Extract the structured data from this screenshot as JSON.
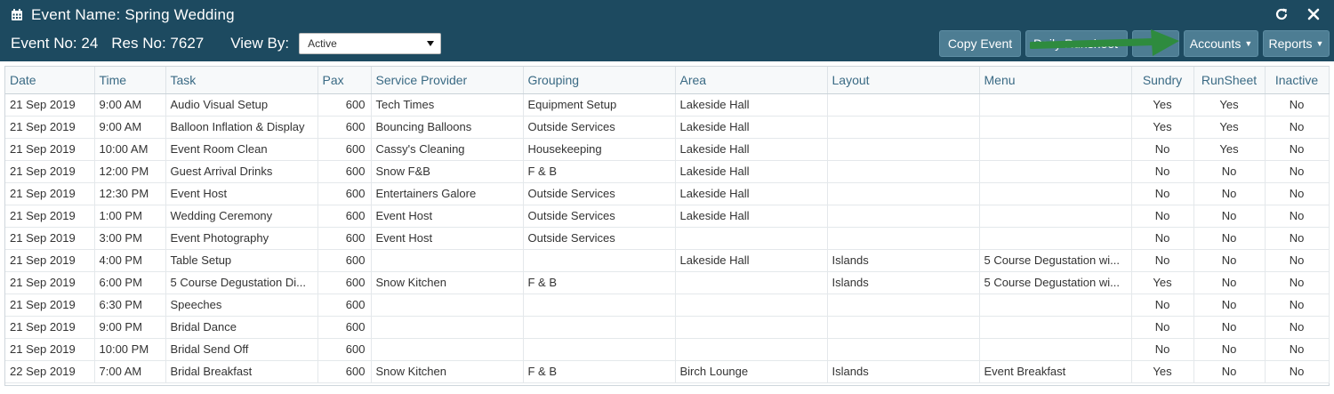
{
  "header": {
    "title": "Event Name: Spring Wedding",
    "event_no": "Event No: 24",
    "res_no": "Res No: 7627",
    "view_by_label": "View By:",
    "view_by_value": "Active",
    "icons": [
      "calendar-icon",
      "refresh-icon",
      "close-icon"
    ]
  },
  "toolbar": {
    "copy_event": "Copy Event",
    "daily": "Daily Runsheet",
    "hidden": "",
    "accounts": "Accounts",
    "reports": "Reports"
  },
  "colors": {
    "header_bg": "#1d4a60",
    "button_bg": "#4d7d93",
    "header_text": "#3a6a84",
    "arrow": "#2e8b3e"
  },
  "table": {
    "columns": [
      "Date",
      "Time",
      "Task",
      "Pax",
      "Service Provider",
      "Grouping",
      "Area",
      "Layout",
      "Menu",
      "Sundry",
      "RunSheet",
      "Inactive"
    ],
    "rows": [
      [
        "21 Sep 2019",
        "9:00 AM",
        "Audio Visual Setup",
        "600",
        "Tech Times",
        "Equipment Setup",
        "Lakeside Hall",
        "",
        "",
        "Yes",
        "Yes",
        "No"
      ],
      [
        "21 Sep 2019",
        "9:00 AM",
        "Balloon Inflation & Display",
        "600",
        "Bouncing Balloons",
        "Outside Services",
        "Lakeside Hall",
        "",
        "",
        "Yes",
        "Yes",
        "No"
      ],
      [
        "21 Sep 2019",
        "10:00 AM",
        "Event Room Clean",
        "600",
        "Cassy's Cleaning",
        "Housekeeping",
        "Lakeside Hall",
        "",
        "",
        "No",
        "Yes",
        "No"
      ],
      [
        "21 Sep 2019",
        "12:00 PM",
        "Guest Arrival Drinks",
        "600",
        "Snow F&B",
        "F & B",
        "Lakeside Hall",
        "",
        "",
        "No",
        "No",
        "No"
      ],
      [
        "21 Sep 2019",
        "12:30 PM",
        "Event Host",
        "600",
        "Entertainers Galore",
        "Outside Services",
        "Lakeside Hall",
        "",
        "",
        "No",
        "No",
        "No"
      ],
      [
        "21 Sep 2019",
        "1:00 PM",
        "Wedding Ceremony",
        "600",
        "Event Host",
        "Outside Services",
        "Lakeside Hall",
        "",
        "",
        "No",
        "No",
        "No"
      ],
      [
        "21 Sep 2019",
        "3:00 PM",
        "Event Photography",
        "600",
        "Event Host",
        "Outside Services",
        "",
        "",
        "",
        "No",
        "No",
        "No"
      ],
      [
        "21 Sep 2019",
        "4:00 PM",
        "Table Setup",
        "600",
        "",
        "",
        "Lakeside Hall",
        "Islands",
        "5 Course Degustation wi...",
        "No",
        "No",
        "No"
      ],
      [
        "21 Sep 2019",
        "6:00 PM",
        "5 Course Degustation Di...",
        "600",
        "Snow Kitchen",
        "F & B",
        "",
        "Islands",
        "5 Course Degustation wi...",
        "Yes",
        "No",
        "No"
      ],
      [
        "21 Sep 2019",
        "6:30 PM",
        "Speeches",
        "600",
        "",
        "",
        "",
        "",
        "",
        "No",
        "No",
        "No"
      ],
      [
        "21 Sep 2019",
        "9:00 PM",
        "Bridal Dance",
        "600",
        "",
        "",
        "",
        "",
        "",
        "No",
        "No",
        "No"
      ],
      [
        "21 Sep 2019",
        "10:00 PM",
        "Bridal Send Off",
        "600",
        "",
        "",
        "",
        "",
        "",
        "No",
        "No",
        "No"
      ],
      [
        "22 Sep 2019",
        "7:00 AM",
        "Bridal Breakfast",
        "600",
        "Snow Kitchen",
        "F & B",
        "Birch Lounge",
        "Islands",
        "Event Breakfast",
        "Yes",
        "No",
        "No"
      ]
    ]
  }
}
